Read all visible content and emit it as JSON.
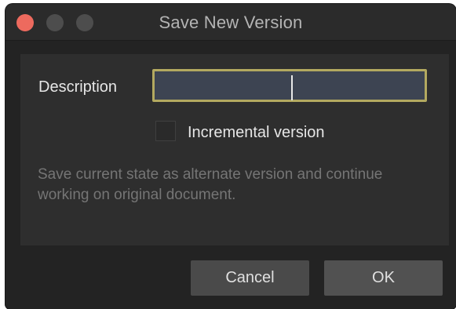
{
  "window": {
    "title": "Save New Version"
  },
  "form": {
    "description_label": "Description",
    "description_value": "",
    "incremental_label": "Incremental version",
    "incremental_checked": false,
    "hint_text": "Save current state as alternate version and continue working on original document."
  },
  "buttons": {
    "cancel_label": "Cancel",
    "ok_label": "OK"
  },
  "colors": {
    "window_bg": "#232323",
    "panel_bg": "#2e2e2e",
    "input_bg": "#3d4452",
    "input_focus_border": "#b3a960",
    "close_button": "#ed6a5e",
    "button_bg": "#4a4a4a"
  },
  "icons": {
    "close": "close-icon",
    "minimize": "minimize-icon",
    "maximize": "maximize-icon"
  }
}
